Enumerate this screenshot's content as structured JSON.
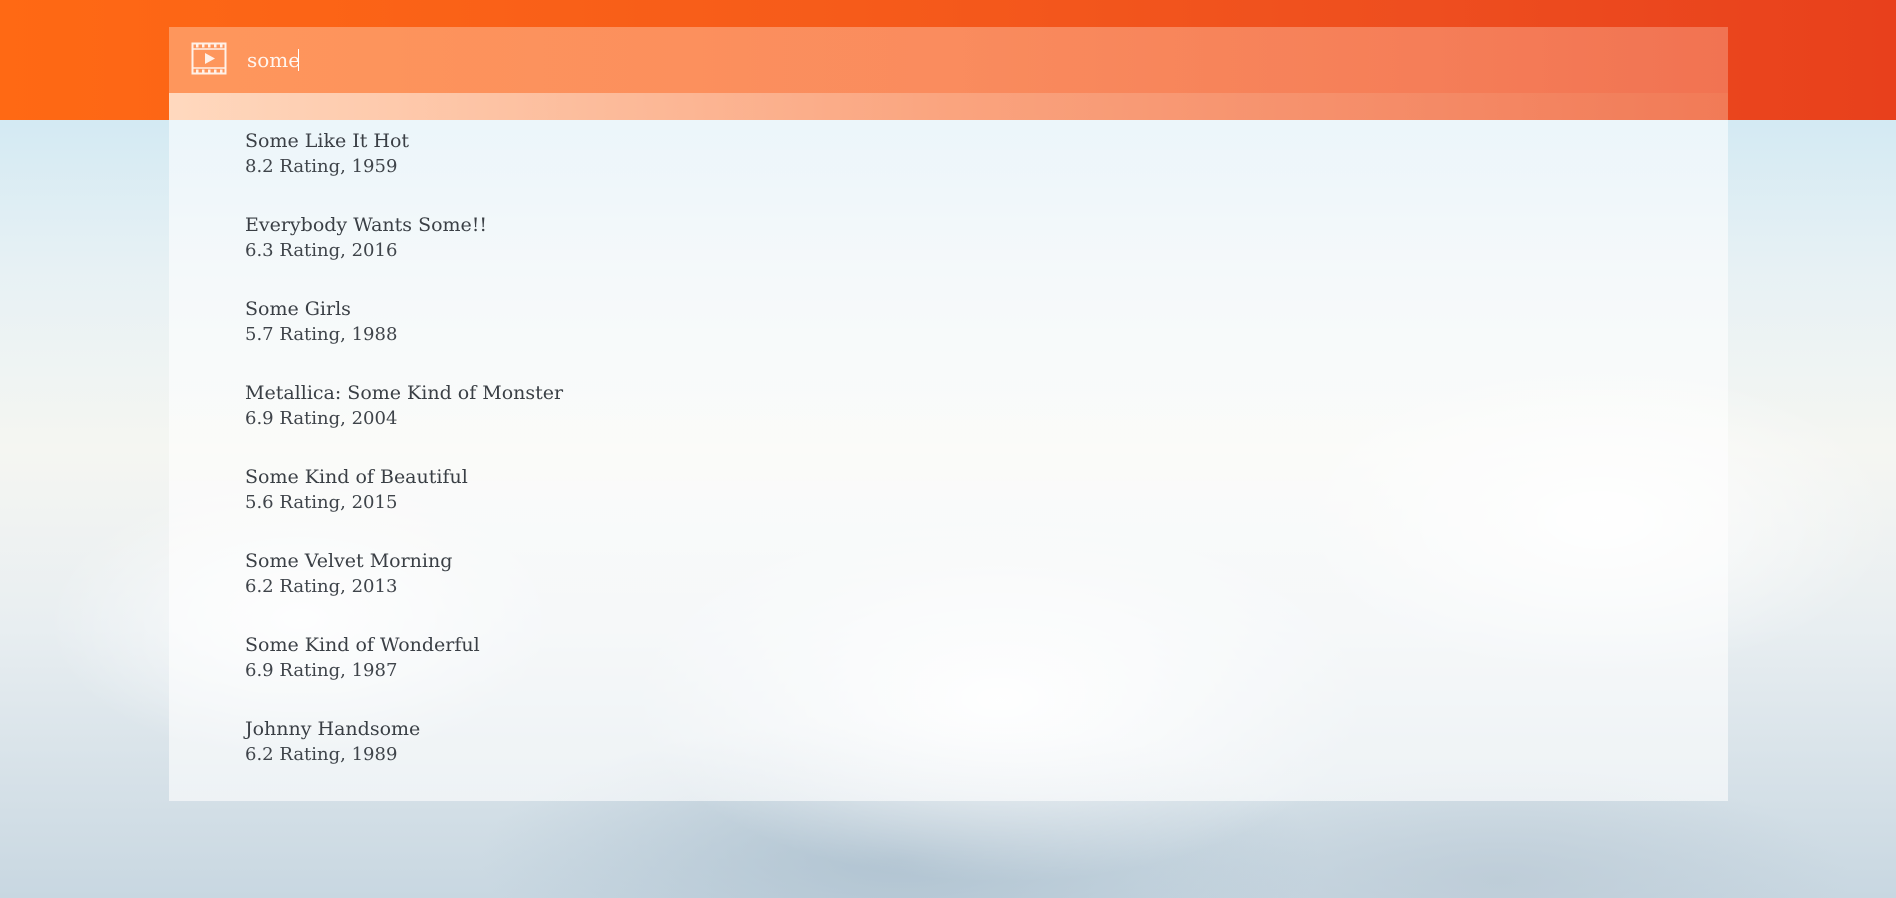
{
  "search": {
    "value": "some",
    "icon": "film-play-icon"
  },
  "results": [
    {
      "title": "Some Like It Hot",
      "meta": "8.2 Rating, 1959"
    },
    {
      "title": "Everybody Wants Some!!",
      "meta": "6.3 Rating, 2016"
    },
    {
      "title": "Some Girls",
      "meta": "5.7 Rating, 1988"
    },
    {
      "title": "Metallica: Some Kind of Monster",
      "meta": "6.9 Rating, 2004"
    },
    {
      "title": "Some Kind of Beautiful",
      "meta": "5.6 Rating, 2015"
    },
    {
      "title": "Some Velvet Morning",
      "meta": "6.2 Rating, 2013"
    },
    {
      "title": "Some Kind of Wonderful",
      "meta": "6.9 Rating, 1987"
    },
    {
      "title": "Johnny Handsome",
      "meta": "6.2 Rating, 1989"
    }
  ],
  "colors": {
    "header_start": "#ff6914",
    "header_end": "#e8401c",
    "text": "#3a3f45"
  }
}
